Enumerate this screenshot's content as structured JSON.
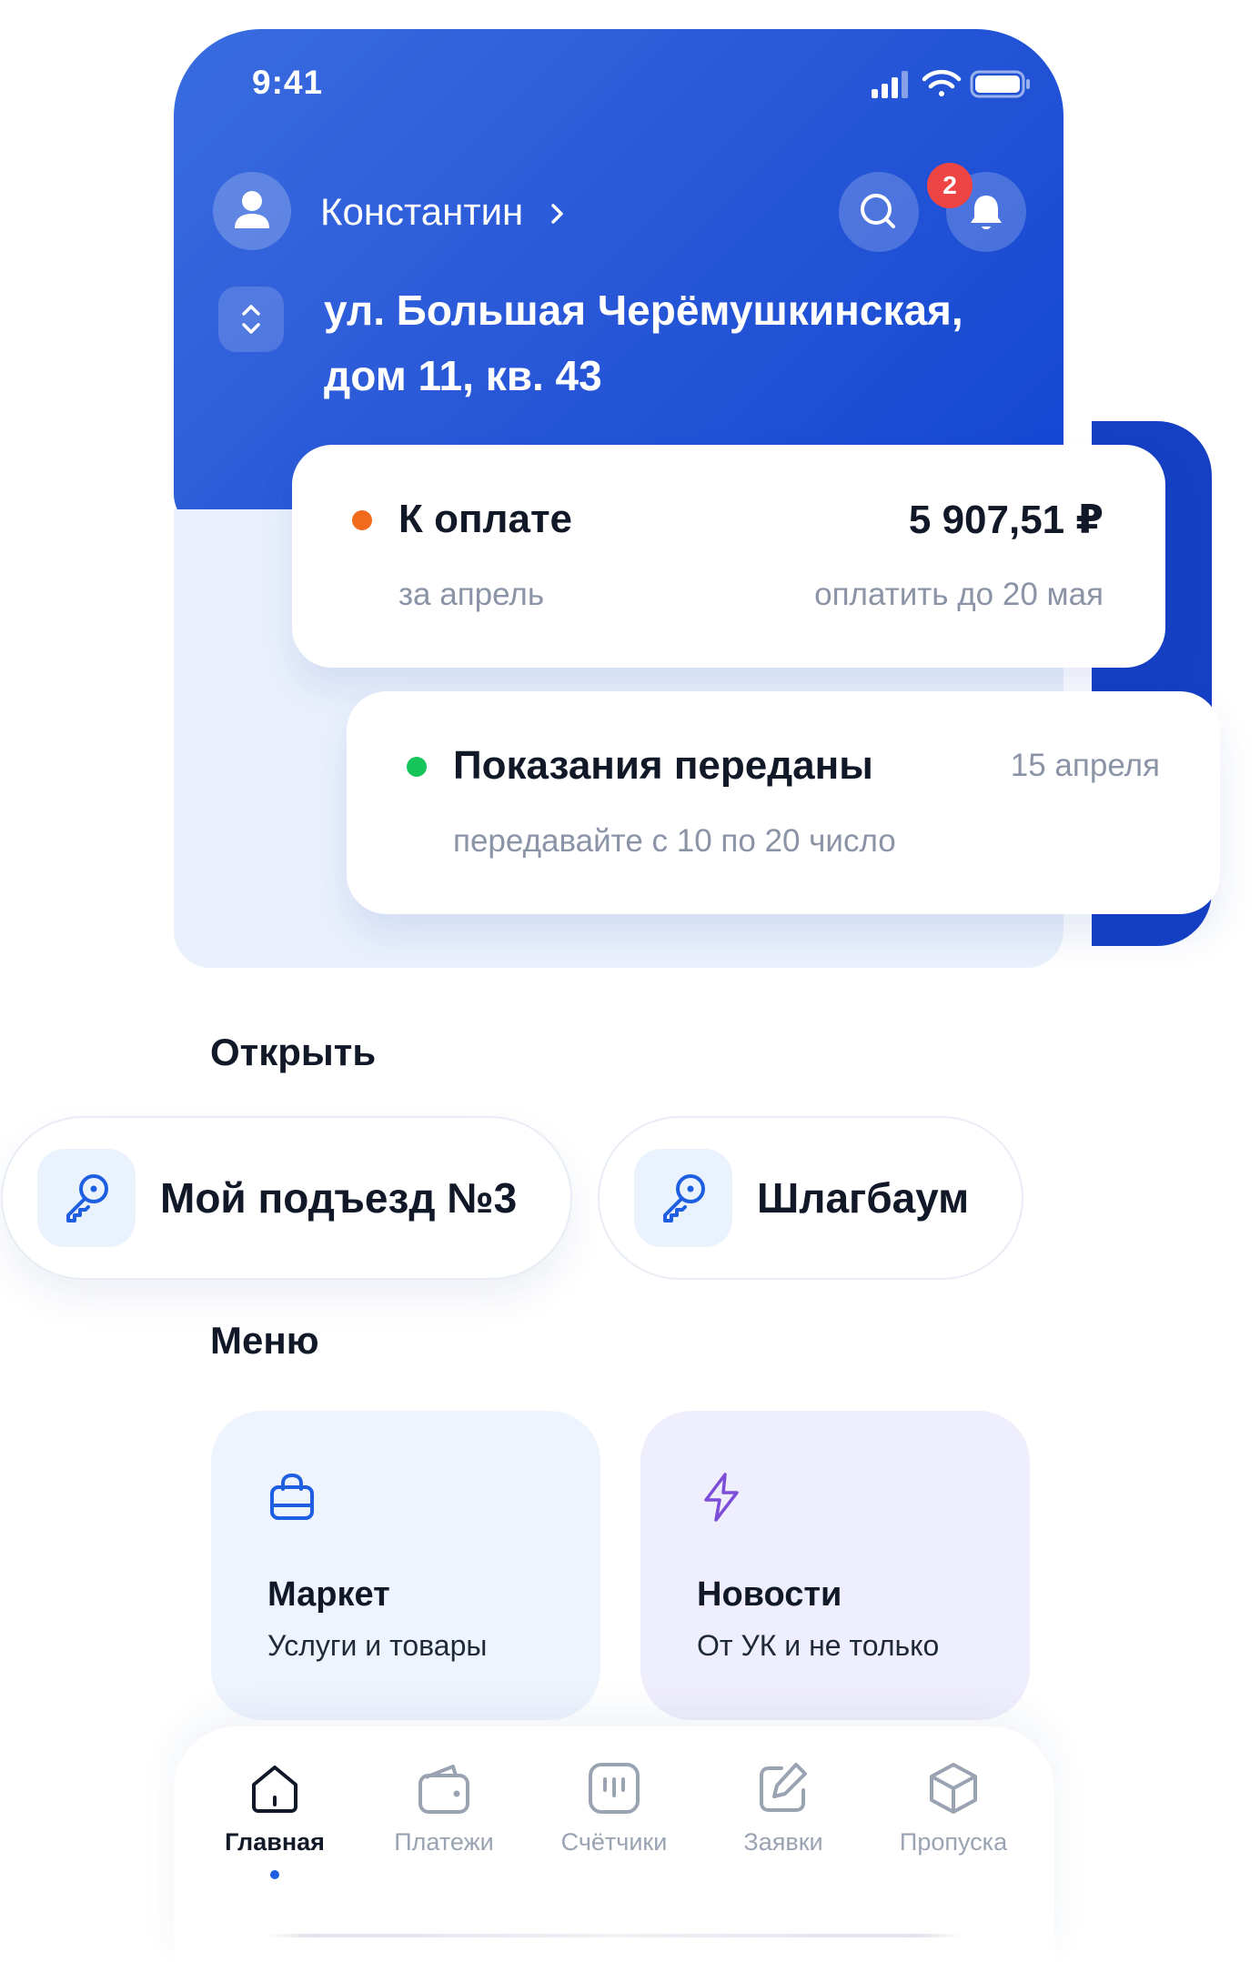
{
  "status_bar": {
    "time": "9:41"
  },
  "header": {
    "user_name": "Константин",
    "notifications_count": "2",
    "address_line1": "ул. Большая Черёмушкинская,",
    "address_line2": "дом 11, кв. 43"
  },
  "payment": {
    "title": "К оплате",
    "amount": "5 907,51 ₽",
    "period": "за апрель",
    "due": "оплатить до 20 мая",
    "status_color": "#f26b1d"
  },
  "meters": {
    "title": "Показания переданы",
    "date": "15 апреля",
    "hint": "передавайте с 10 по 20 число",
    "status_color": "#16c45a"
  },
  "open_section": {
    "title": "Открыть",
    "items": [
      {
        "label": "Мой подъезд №3",
        "icon": "key-icon"
      },
      {
        "label": "Шлагбаум",
        "icon": "key-icon"
      }
    ]
  },
  "menu_section": {
    "title": "Меню",
    "items": [
      {
        "title": "Маркет",
        "subtitle": "Услуги и товары",
        "icon": "shopping-bag-icon"
      },
      {
        "title": "Новости",
        "subtitle": "От УК и не только",
        "icon": "lightning-icon"
      }
    ]
  },
  "tabbar": {
    "items": [
      {
        "label": "Главная",
        "icon": "home-icon",
        "active": true
      },
      {
        "label": "Платежи",
        "icon": "wallet-icon",
        "active": false
      },
      {
        "label": "Счётчики",
        "icon": "meter-icon",
        "active": false
      },
      {
        "label": "Заявки",
        "icon": "edit-icon",
        "active": false
      },
      {
        "label": "Пропуска",
        "icon": "box-icon",
        "active": false
      }
    ]
  },
  "colors": {
    "brand_blue": "#2456d8",
    "accent_blue": "#1d5fe0",
    "news_accent": "#7c4dd8"
  }
}
